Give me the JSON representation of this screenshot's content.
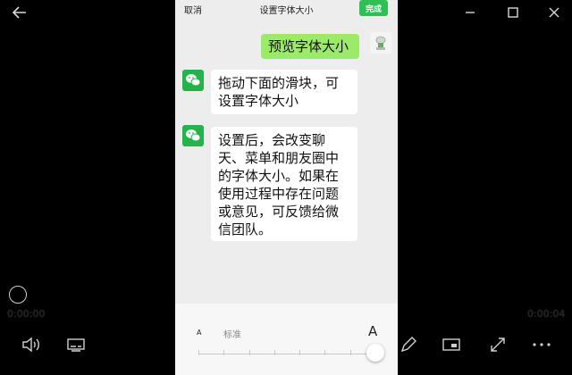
{
  "player": {
    "time_elapsed": "0:00:00",
    "time_total": "0:00:04",
    "progress": 0.0
  },
  "phone": {
    "header": {
      "cancel_label": "取消",
      "title": "设置字体大小",
      "done_label": "完成"
    },
    "messages": [
      {
        "sender": "me",
        "text": "预览字体大小"
      },
      {
        "sender": "wechat",
        "text": "拖动下面的滑块，可设置字体大小"
      },
      {
        "sender": "wechat",
        "text": "设置后，会改变聊天、菜单和朋友圈中的字体大小。如果在使用过程中存在问题或意见，可反馈给微信团队。"
      }
    ],
    "font_size": {
      "small_label": "A",
      "standard_label": "标准",
      "large_label": "A",
      "steps": 8,
      "current_step": 8
    }
  },
  "colors": {
    "done_button": "#2fbf55",
    "my_bubble": "#9bea6a",
    "wechat_avatar": "#24b34b",
    "chat_background": "#ededed"
  },
  "icons": {
    "back": "arrow-left-icon",
    "window": [
      "minimize-icon",
      "maximize-icon",
      "close-icon"
    ],
    "player_bottom": [
      "volume-icon",
      "subtitle-icon",
      "edit-icon",
      "screen-icon",
      "fullscreen-icon",
      "more-icon"
    ]
  }
}
